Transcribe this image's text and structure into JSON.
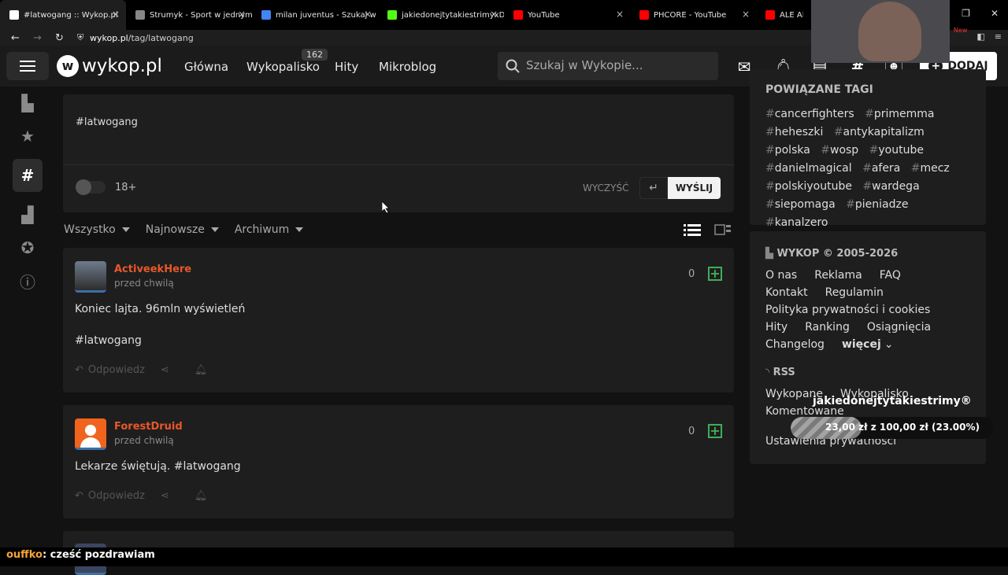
{
  "browser": {
    "tabs": [
      {
        "title": "#latwogang :: Wykop.pl",
        "active": true,
        "color": "#ffffff"
      },
      {
        "title": "Strumyk - Sport w jednym",
        "active": false,
        "color": "#888888"
      },
      {
        "title": "milan juventus - Szukaj w Go",
        "active": false,
        "color": "#4285f4"
      },
      {
        "title": "jakiedonejtytakiestrimyxD Str",
        "active": false,
        "color": "#53fc18"
      },
      {
        "title": "YouTube",
        "active": false,
        "color": "#ff0000"
      },
      {
        "title": "PHCORE - YouTube",
        "active": false,
        "color": "#ff0000"
      },
      {
        "title": "ALE ALE A",
        "active": false,
        "color": "#ff0000"
      }
    ],
    "url_domain": "wykop.pl",
    "url_path": "/tag/latwogang",
    "new_badge": "New"
  },
  "nav": {
    "logo": "wykop.pl",
    "links": [
      "Główna",
      "Wykopalisko",
      "Hity",
      "Mikroblog"
    ],
    "wykopalisko_count": "162",
    "search_placeholder": "Szukaj w Wykopie...",
    "add_label": "DODAJ"
  },
  "composer": {
    "text": "#latwogang",
    "adult_label": "18+",
    "clear_label": "WYCZYŚĆ",
    "send_label": "WYŚLIJ"
  },
  "filters": [
    "Wszystko",
    "Najnowsze",
    "Archiwum"
  ],
  "posts": [
    {
      "author": "ActiveekHere",
      "time": "przed chwilą",
      "votes": "0",
      "lines": [
        "Koniec lajta. 96mln wyświetleń",
        "#latwogang"
      ],
      "reply_label": "Odpowiedz"
    },
    {
      "author": "ForestDruid",
      "time": "przed chwilą",
      "votes": "0",
      "lines": [
        "Lekarze świętują. ",
        "#latwogang"
      ],
      "reply_label": "Odpowiedz"
    }
  ],
  "sidebar": {
    "related_title": "POWIĄZANE TAGI",
    "tags": [
      "cancerfighters",
      "primemma",
      "heheszki",
      "antykapitalizm",
      "polska",
      "wosp",
      "youtube",
      "danielmagical",
      "afera",
      "mecz",
      "polskiyoutube",
      "wardega",
      "siepomaga",
      "pieniadze",
      "kanalzero"
    ],
    "footer_title": "WYKOP © 2005-2026",
    "footer_links": [
      [
        "O nas",
        "Reklama",
        "FAQ"
      ],
      [
        "Kontakt",
        "Regulamin"
      ],
      [
        "Polityka prywatności i cookies"
      ],
      [
        "Hity",
        "Ranking",
        "Osiągnięcia"
      ],
      [
        "Changelog",
        "więcej"
      ]
    ],
    "rss_title": "RSS",
    "rss_links": [
      "Wykopane",
      "Wykopalisko",
      "Komentowane"
    ],
    "privacy": "Ustawienia prywatności"
  },
  "donation": {
    "name": "jakiedonejtytakiestrimy®",
    "progress_text": "23,00 zł z 100,00 zł (23.00%)",
    "progress": 0.23
  },
  "chat": {
    "user": "ouffko",
    "message": ": cześć pozdrawiam"
  }
}
